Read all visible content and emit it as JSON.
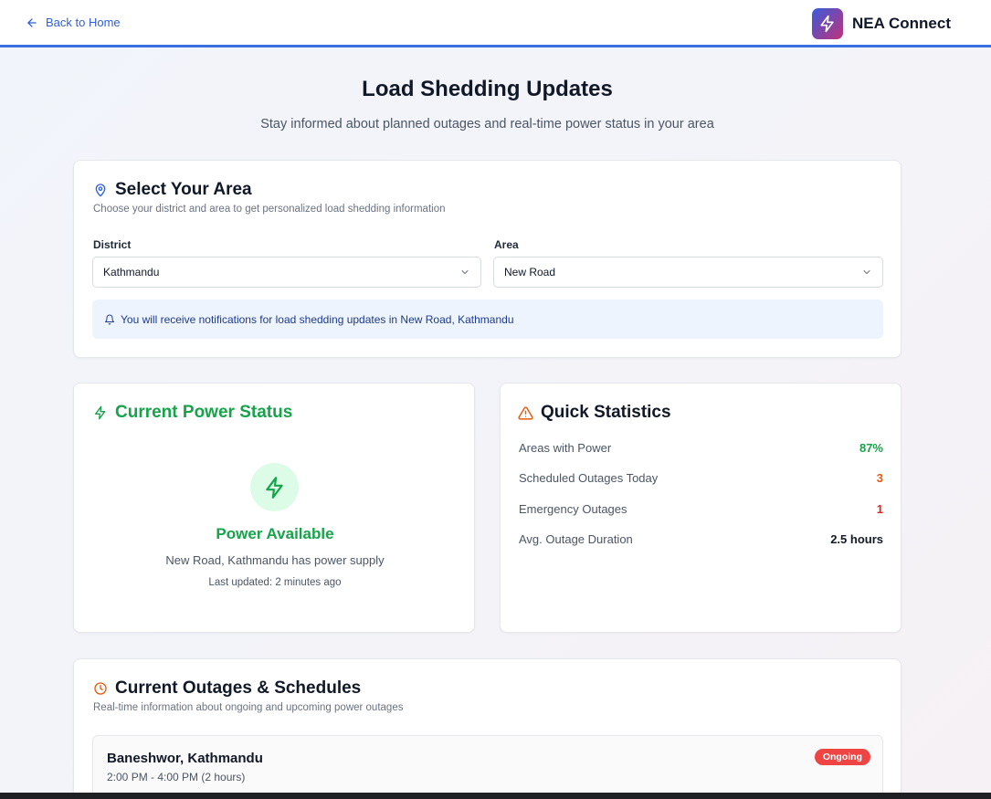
{
  "header": {
    "back_label": "Back to Home",
    "brand_name": "NEA Connect"
  },
  "page": {
    "title": "Load Shedding Updates",
    "subtitle": "Stay informed about planned outages and real-time power status in your area"
  },
  "area_selector": {
    "title": "Select Your Area",
    "description": "Choose your district and area to get personalized load shedding information",
    "district_label": "District",
    "district_value": "Kathmandu",
    "area_label": "Area",
    "area_value": "New Road",
    "notice": "You will receive notifications for load shedding updates in New Road, Kathmandu"
  },
  "power_status": {
    "title": "Current Power Status",
    "status": "Power Available",
    "location_text": "New Road, Kathmandu has power supply",
    "last_updated": "Last updated: 2 minutes ago"
  },
  "quick_stats": {
    "title": "Quick Statistics",
    "rows": [
      {
        "label": "Areas with Power",
        "value": "87%",
        "color": "#16a34a"
      },
      {
        "label": "Scheduled Outages Today",
        "value": "3",
        "color": "#ea580c"
      },
      {
        "label": "Emergency Outages",
        "value": "1",
        "color": "#dc2626"
      },
      {
        "label": "Avg. Outage Duration",
        "value": "2.5 hours",
        "color": "#111827"
      }
    ]
  },
  "outages": {
    "title": "Current Outages & Schedules",
    "description": "Real-time information about ongoing and upcoming power outages",
    "items": [
      {
        "location": "Baneshwor, Kathmandu",
        "time": "2:00 PM - 4:00 PM (2 hours)",
        "status": "Ongoing"
      }
    ]
  },
  "colors": {
    "accent": "#3b6fe0",
    "success": "#16a34a",
    "warning": "#ea580c",
    "danger": "#ef4444"
  },
  "icons": {
    "back": "arrow-left-icon",
    "brand": "lightning-bolt-icon",
    "area": "map-pin-icon",
    "notice": "bell-icon",
    "power": "lightning-bolt-icon",
    "stats": "warning-triangle-icon",
    "outages": "clock-icon",
    "dropdown": "chevron-down-icon"
  }
}
